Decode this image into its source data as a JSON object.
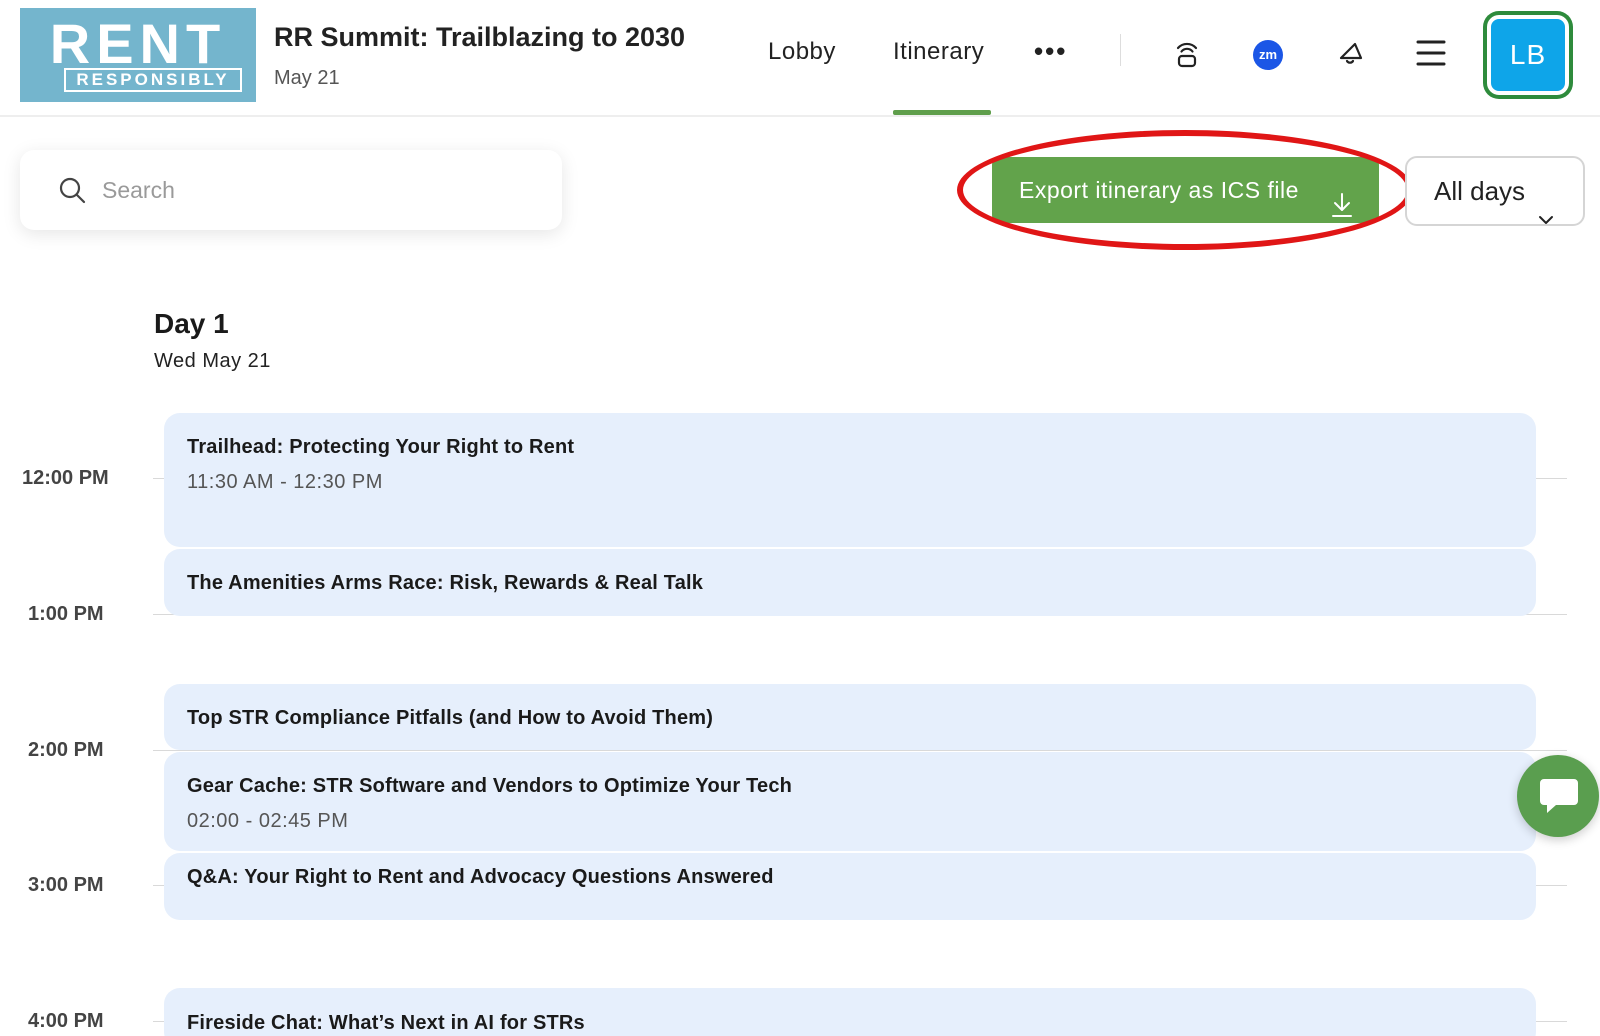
{
  "header": {
    "logo_top": "RENT",
    "logo_bottom": "RESPONSIBLY",
    "event_title": "RR Summit: Trailblazing to 2030",
    "event_date": "May 21",
    "nav": {
      "lobby": "Lobby",
      "itinerary": "Itinerary",
      "more": "•••"
    },
    "icons": [
      "stream-icon",
      "zoom-icon",
      "announcement-icon",
      "menu-icon"
    ],
    "zoom_label": "zm",
    "avatar_initials": "LB",
    "accent_color": "#62a34b",
    "avatar_color": "#0ea5e9"
  },
  "toolbar": {
    "search_placeholder": "Search",
    "export_label": "Export itinerary as ICS file",
    "days_filter": "All days",
    "highlight_color": "#e01616"
  },
  "day": {
    "title": "Day 1",
    "date": "Wed May 21"
  },
  "timeline": {
    "hours": [
      "12:00 PM",
      "1:00 PM",
      "2:00 PM",
      "3:00 PM",
      "4:00 PM"
    ],
    "sessions": [
      {
        "title": "Trailhead: Protecting Your Right to Rent",
        "time": "11:30 AM - 12:30 PM"
      },
      {
        "title": "The Amenities Arms Race: Risk, Rewards & Real Talk",
        "time": ""
      },
      {
        "title": "Top STR Compliance Pitfalls (and How to Avoid Them)",
        "time": ""
      },
      {
        "title": "Gear Cache: STR Software and Vendors to Optimize Your Tech",
        "time": "02:00 - 02:45 PM"
      },
      {
        "title": "Q&A: Your Right to Rent and Advocacy Questions Answered",
        "time": ""
      },
      {
        "title": "Fireside Chat: What’s Next in AI for STRs",
        "time": ""
      }
    ],
    "session_color": "#e6effc"
  },
  "chat": {
    "icon": "chat-bubble-icon"
  }
}
